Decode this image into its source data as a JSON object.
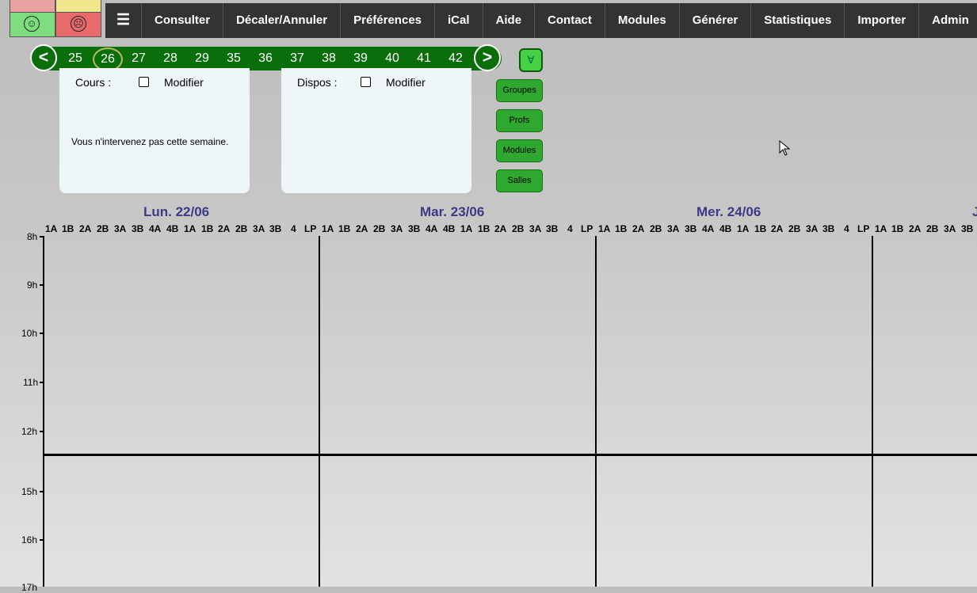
{
  "nav": {
    "menu_icon": "☰",
    "items": [
      "Consulter",
      "Décaler/Annuler",
      "Préférences",
      "iCal",
      "Aide",
      "Contact",
      "Modules",
      "Générer",
      "Statistiques",
      "Importer",
      "Admin"
    ]
  },
  "weeks": {
    "prev": "<",
    "next": ">",
    "list": [
      "25",
      "26",
      "27",
      "28",
      "29",
      "35",
      "36",
      "37",
      "38",
      "39",
      "40",
      "41",
      "42"
    ],
    "current": "26",
    "all_button": "∀"
  },
  "panel_cours": {
    "label": "Cours :",
    "checkbox_label": "Modifier",
    "message": "Vous n'intervenez pas cette semaine."
  },
  "panel_dispos": {
    "label": "Dispos :",
    "checkbox_label": "Modifier"
  },
  "filters": [
    "Groupes",
    "Profs",
    "Modules",
    "Salles"
  ],
  "days": [
    "Lun. 22/06",
    "Mar. 23/06",
    "Mer. 24/06",
    "J"
  ],
  "groups": [
    "1A",
    "1B",
    "2A",
    "2B",
    "3A",
    "3B",
    "4A",
    "4B",
    "1A",
    "1B",
    "2A",
    "2B",
    "3A",
    "3B",
    "4",
    "LP"
  ],
  "hours": [
    "8h",
    "9h",
    "10h",
    "11h",
    "12h",
    "15h",
    "16h",
    "17h"
  ],
  "colors": {
    "nav_bg": "#333333",
    "week_bar": "#0a6e0a",
    "filter_button": "#2ea82e",
    "day_header": "#3a3a86",
    "panel_bg": "#eef6f8"
  }
}
